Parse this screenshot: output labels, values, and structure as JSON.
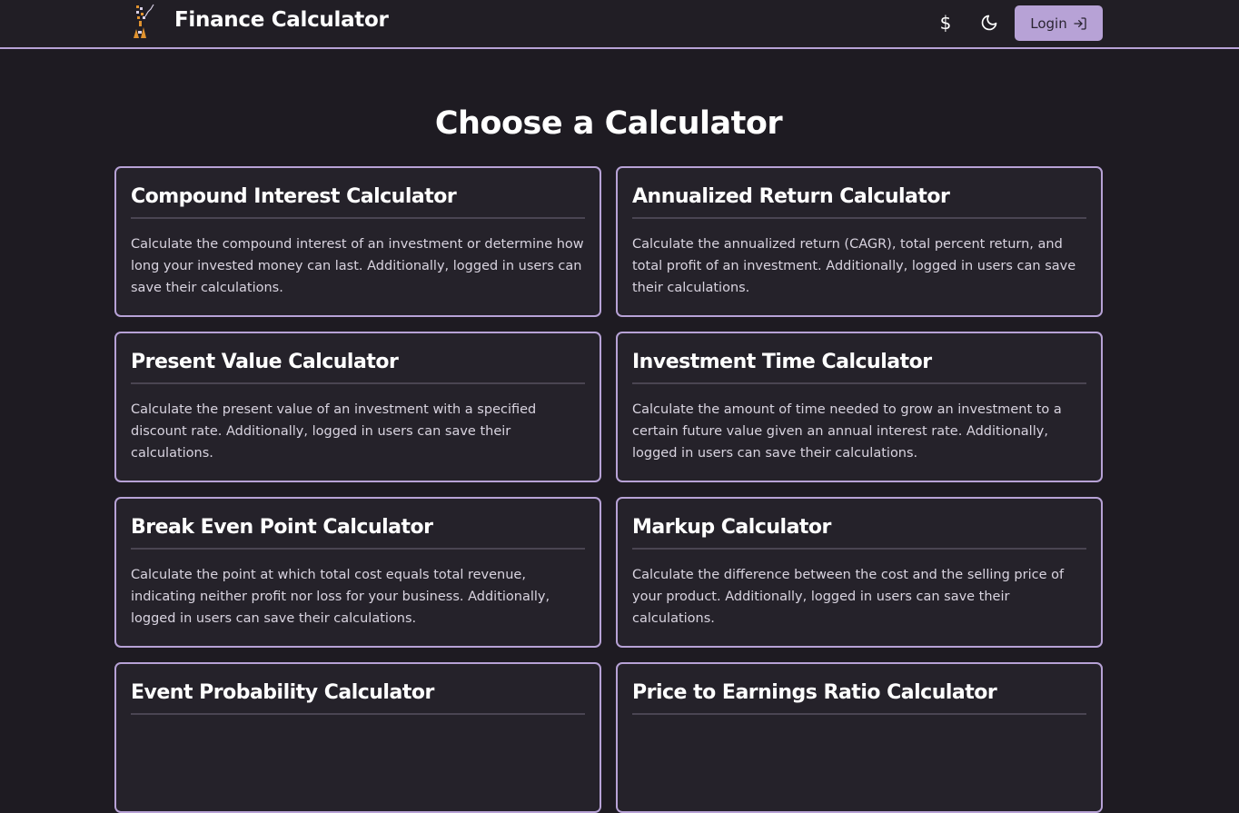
{
  "header": {
    "title": "Finance Calculator",
    "currency_icon": "$",
    "theme_icon": "moon-icon",
    "login_label": "Login",
    "login_icon": "login-arrow-icon"
  },
  "main": {
    "heading": "Choose a Calculator",
    "cards": [
      {
        "title": "Compound Interest Calculator",
        "description": "Calculate the compound interest of an investment or determine how long your invested money can last. Additionally, logged in users can save their calculations."
      },
      {
        "title": "Annualized Return Calculator",
        "description": "Calculate the annualized return (CAGR), total percent return, and total profit of an investment. Additionally, logged in users can save their calculations."
      },
      {
        "title": "Present Value Calculator",
        "description": "Calculate the present value of an investment with a specified discount rate. Additionally, logged in users can save their calculations."
      },
      {
        "title": "Investment Time Calculator",
        "description": "Calculate the amount of time needed to grow an investment to a certain future value given an annual interest rate. Additionally, logged in users can save their calculations."
      },
      {
        "title": "Break Even Point Calculator",
        "description": "Calculate the point at which total cost equals total revenue, indicating neither profit nor loss for your business. Additionally, logged in users can save their calculations."
      },
      {
        "title": "Markup Calculator",
        "description": "Calculate the difference between the cost and the selling price of your product. Additionally, logged in users can save their calculations."
      },
      {
        "title": "Event Probability Calculator",
        "description": ""
      },
      {
        "title": "Price to Earnings Ratio Calculator",
        "description": ""
      }
    ]
  },
  "colors": {
    "background": "#1e1b22",
    "card_background": "#25222a",
    "accent": "#b7a2d6",
    "logo_orange": "#e0922e"
  }
}
